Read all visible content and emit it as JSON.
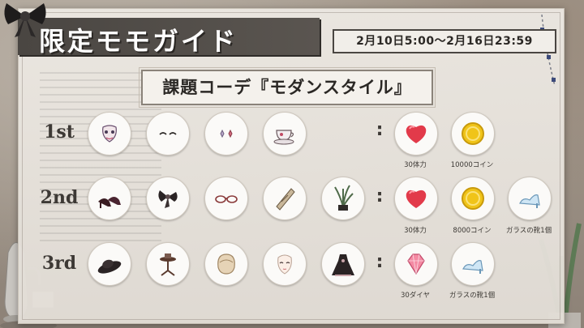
{
  "header": {
    "title": "限定モモガイド",
    "period": "2月10日5:00〜2月16日23:59",
    "theme": "課題コーデ『モダンスタイル』"
  },
  "rows": [
    {
      "label": "1st",
      "items": [
        "mask-icon",
        "eyelash-icon",
        "earrings-icon",
        "teacup-icon"
      ],
      "rewards": [
        {
          "icon": "heart-icon",
          "label": "30体力"
        },
        {
          "icon": "coin-icon",
          "label": "10000コイン"
        }
      ]
    },
    {
      "label": "2nd",
      "items": [
        "heels-icon",
        "hair-bow-icon",
        "glasses-icon",
        "scarf-icon",
        "potted-plant-icon"
      ],
      "rewards": [
        {
          "icon": "heart-icon",
          "label": "30体力"
        },
        {
          "icon": "coin-icon",
          "label": "8000コイン"
        },
        {
          "icon": "glass-slipper-icon",
          "label": "ガラスの靴1個"
        }
      ]
    },
    {
      "label": "3rd",
      "items": [
        "hat-icon",
        "side-table-icon",
        "hairstyle-icon",
        "face-icon",
        "dress-icon"
      ],
      "rewards": [
        {
          "icon": "diamond-icon",
          "label": "30ダイヤ"
        },
        {
          "icon": "glass-slipper-icon",
          "label": "ガラスの靴1個"
        }
      ]
    }
  ],
  "separator": ":",
  "colors": {
    "title_bar": "#4a4642",
    "panel": "#ece8e2",
    "heart": "#e23a4a",
    "coin": "#f0c419",
    "diamond": "#f48aa3"
  }
}
